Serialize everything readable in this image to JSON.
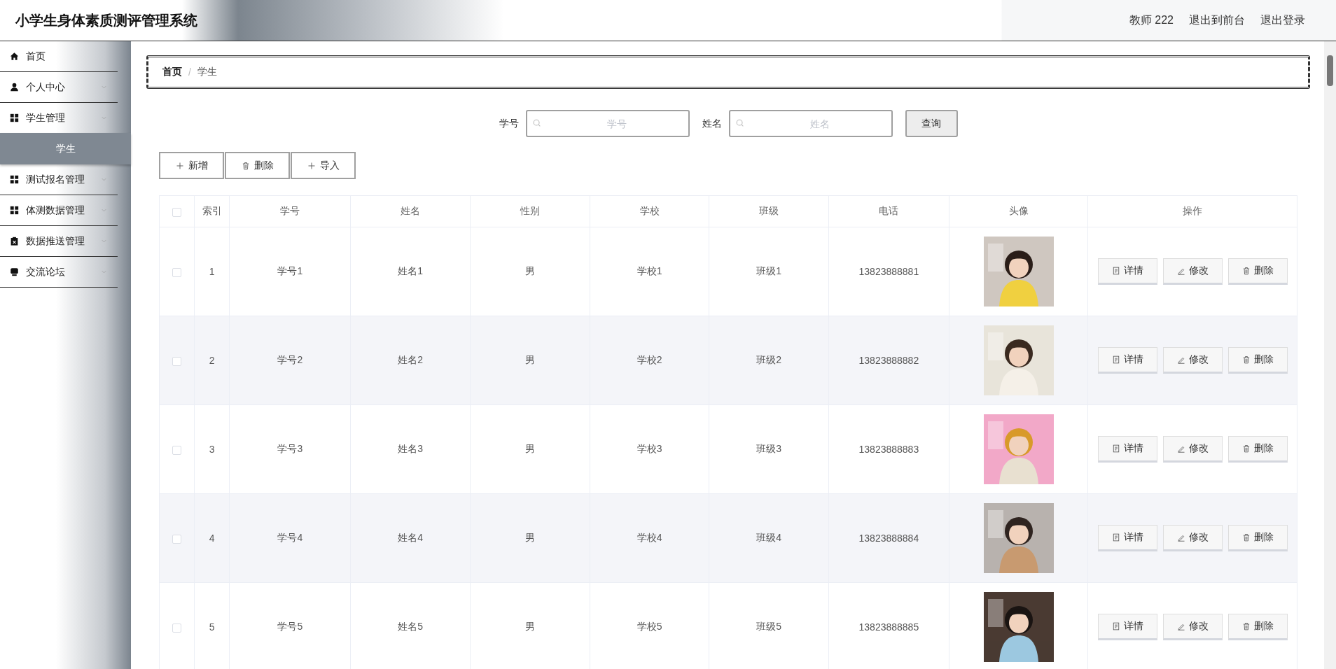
{
  "header": {
    "title": "小学生身体素质测评管理系统",
    "user": "教师 222",
    "links": [
      "退出到前台",
      "退出登录"
    ]
  },
  "sidebar": {
    "items": [
      {
        "label": "首页",
        "kind": "home",
        "has_submenu": false,
        "selected": false
      },
      {
        "label": "个人中心",
        "kind": "person",
        "has_submenu": true,
        "selected": false
      },
      {
        "label": "学生管理",
        "kind": "grid",
        "has_submenu": true,
        "selected": false,
        "children": [
          {
            "label": "学生",
            "selected": true
          }
        ]
      },
      {
        "label": "测试报名管理",
        "kind": "grid",
        "has_submenu": true,
        "selected": false
      },
      {
        "label": "体测数据管理",
        "kind": "grid",
        "has_submenu": true,
        "selected": false
      },
      {
        "label": "数据推送管理",
        "kind": "clipboard",
        "has_submenu": true,
        "selected": false
      },
      {
        "label": "交流论坛",
        "kind": "chat",
        "has_submenu": true,
        "selected": false
      }
    ]
  },
  "breadcrumb": {
    "items": [
      "首页",
      "学生"
    ],
    "separator": "/"
  },
  "search": {
    "fields": [
      {
        "label": "学号",
        "placeholder": "学号"
      },
      {
        "label": "姓名",
        "placeholder": "姓名"
      }
    ],
    "button": "查询"
  },
  "actions": [
    {
      "kind": "add",
      "label": "新增"
    },
    {
      "kind": "delete",
      "label": "删除"
    },
    {
      "kind": "import",
      "label": "导入"
    }
  ],
  "table": {
    "select_all": false,
    "columns": [
      "索引",
      "学号",
      "姓名",
      "性别",
      "学校",
      "班级",
      "电话",
      "头像",
      "操作"
    ],
    "rows": [
      {
        "checked": false,
        "cells": [
          "1",
          "学号1",
          "姓名1",
          "男",
          "学校1",
          "班级1",
          "13823888881"
        ],
        "actions": [
          {
            "kind": "detail",
            "label": "详情"
          },
          {
            "kind": "edit",
            "label": "修改"
          },
          {
            "kind": "delete",
            "label": "删除"
          }
        ]
      },
      {
        "checked": false,
        "cells": [
          "2",
          "学号2",
          "姓名2",
          "男",
          "学校2",
          "班级2",
          "13823888882"
        ],
        "actions": [
          {
            "kind": "detail",
            "label": "详情"
          },
          {
            "kind": "edit",
            "label": "修改"
          },
          {
            "kind": "delete",
            "label": "删除"
          }
        ]
      },
      {
        "checked": false,
        "cells": [
          "3",
          "学号3",
          "姓名3",
          "男",
          "学校3",
          "班级3",
          "13823888883"
        ],
        "actions": [
          {
            "kind": "detail",
            "label": "详情"
          },
          {
            "kind": "edit",
            "label": "修改"
          },
          {
            "kind": "delete",
            "label": "删除"
          }
        ]
      },
      {
        "checked": false,
        "cells": [
          "4",
          "学号4",
          "姓名4",
          "男",
          "学校4",
          "班级4",
          "13823888884"
        ],
        "actions": [
          {
            "kind": "detail",
            "label": "详情"
          },
          {
            "kind": "edit",
            "label": "修改"
          },
          {
            "kind": "delete",
            "label": "删除"
          }
        ]
      },
      {
        "checked": false,
        "cells": [
          "5",
          "学号5",
          "姓名5",
          "男",
          "学校5",
          "班级5",
          "13823888885"
        ],
        "actions": [
          {
            "kind": "detail",
            "label": "详情"
          },
          {
            "kind": "edit",
            "label": "修改"
          },
          {
            "kind": "delete",
            "label": "删除"
          }
        ]
      }
    ]
  }
}
